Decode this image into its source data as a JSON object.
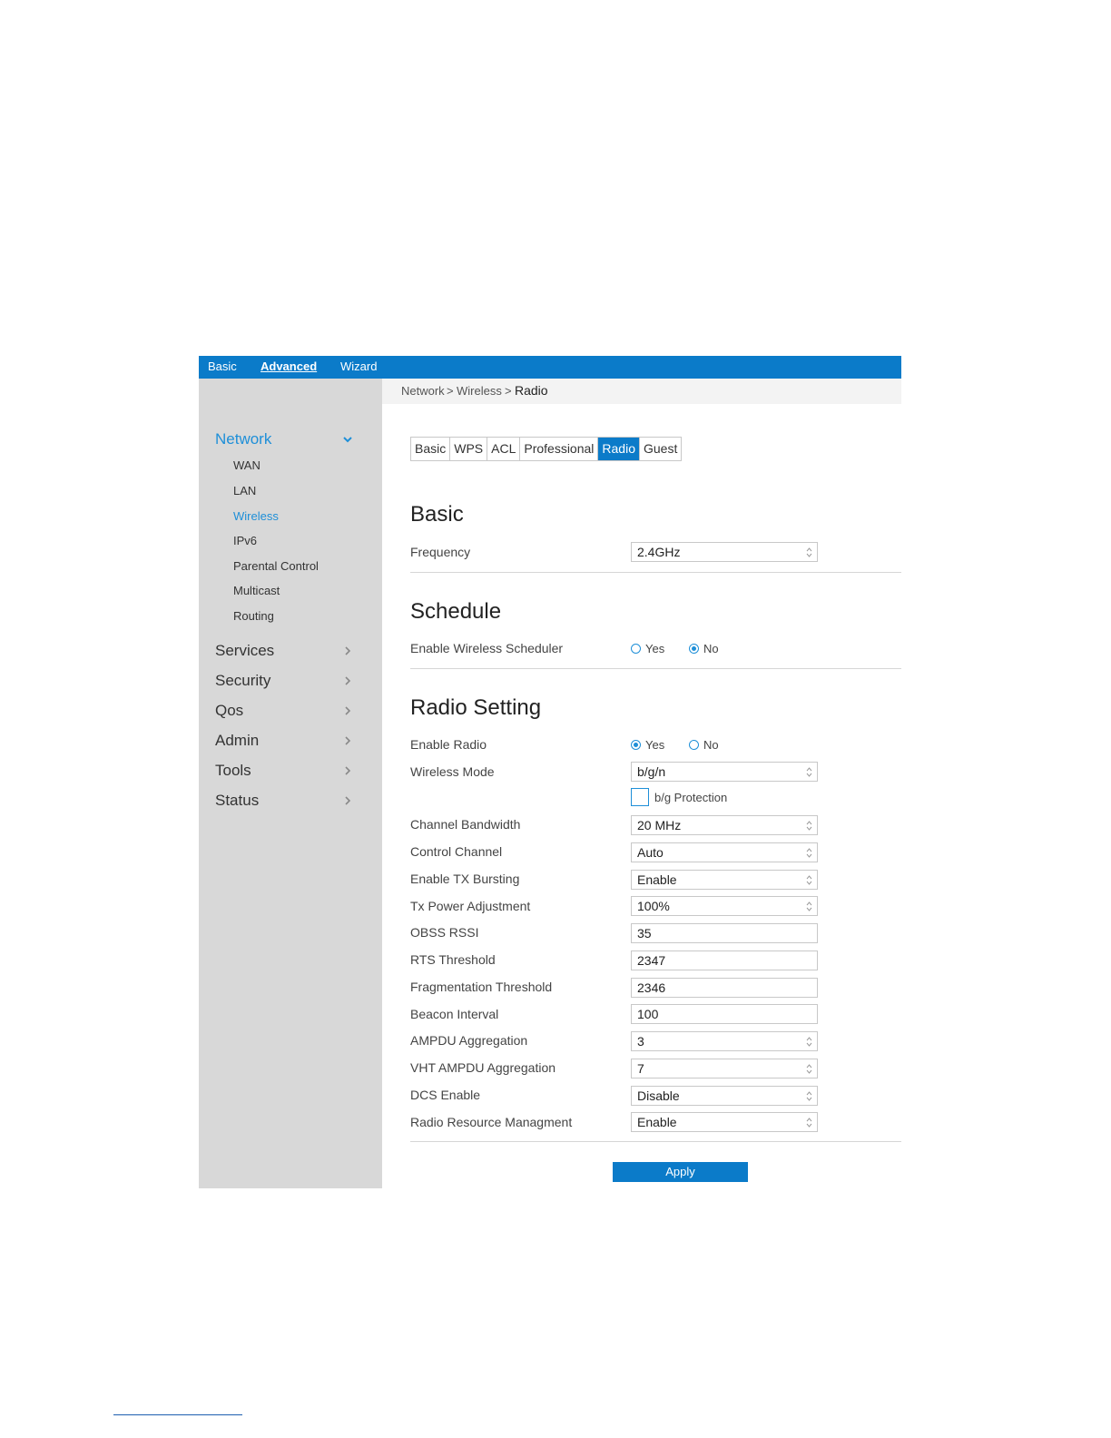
{
  "topnav": {
    "basic": "Basic",
    "advanced": "Advanced",
    "wizard": "Wizard"
  },
  "sidebar": {
    "network": "Network",
    "subitems": [
      "WAN",
      "LAN",
      "Wireless",
      "IPv6",
      "Parental Control",
      "Multicast",
      "Routing"
    ],
    "sections": [
      "Services",
      "Security",
      "Qos",
      "Admin",
      "Tools",
      "Status"
    ]
  },
  "breadcrumb": {
    "part1": "Network",
    "sep": ">",
    "part2": "Wireless",
    "part3": "Radio"
  },
  "tabs": [
    "Basic",
    "WPS",
    "ACL",
    "Professional",
    "Radio",
    "Guest"
  ],
  "basic": {
    "heading": "Basic",
    "frequency_label": "Frequency",
    "frequency_value": "2.4GHz"
  },
  "schedule": {
    "heading": "Schedule",
    "label": "Enable Wireless Scheduler",
    "yes": "Yes",
    "no": "No"
  },
  "radio": {
    "heading": "Radio Setting",
    "enable_radio_label": "Enable Radio",
    "yes": "Yes",
    "no": "No",
    "wireless_mode_label": "Wireless Mode",
    "wireless_mode_value": "b/g/n",
    "bg_protection_label": "b/g Protection",
    "rows": [
      {
        "label": "Channel Bandwidth",
        "value": "20 MHz"
      },
      {
        "label": "Control Channel",
        "value": "Auto"
      },
      {
        "label": "Enable TX Bursting",
        "value": "Enable"
      },
      {
        "label": "Tx Power Adjustment",
        "value": "100%"
      },
      {
        "label": "OBSS RSSI",
        "value": "35"
      },
      {
        "label": "RTS Threshold",
        "value": "2347"
      },
      {
        "label": "Fragmentation Threshold",
        "value": "2346"
      },
      {
        "label": "Beacon Interval",
        "value": "100"
      },
      {
        "label": "AMPDU Aggregation",
        "value": "3"
      },
      {
        "label": "VHT AMPDU Aggregation",
        "value": "7"
      },
      {
        "label": "DCS Enable",
        "value": "Disable"
      },
      {
        "label": "Radio Resource Managment",
        "value": "Enable"
      }
    ]
  },
  "apply_label": "Apply"
}
